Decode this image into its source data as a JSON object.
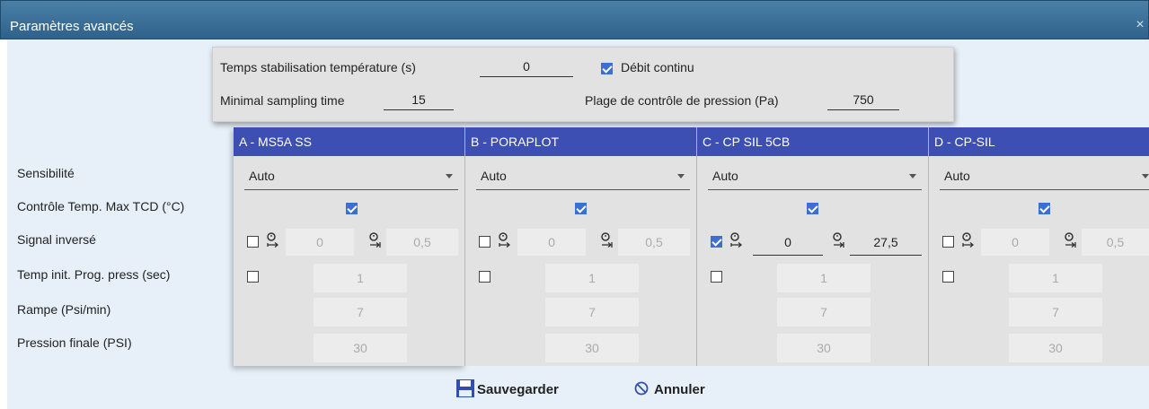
{
  "window": {
    "title": "Paramètres avancés",
    "close_glyph": "×"
  },
  "top": {
    "temp_stab_label": "Temps stabilisation température (s)",
    "temp_stab_value": "0",
    "debit_label": "Débit continu",
    "debit_checked": true,
    "min_sampling_label": "Minimal sampling time",
    "min_sampling_value": "15",
    "plage_label": "Plage de contrôle de pression (Pa)",
    "plage_value": "750"
  },
  "rows": {
    "sensibilite": "Sensibilité",
    "controle": "Contrôle Temp. Max TCD (°C)",
    "signal": "Signal inversé",
    "temp_init": "Temp init. Prog. press (sec)",
    "rampe": "Rampe (Psi/min)",
    "pression": "Pression finale (PSI)"
  },
  "channels": [
    {
      "name": "A - MS5A SS",
      "sensibilite": "Auto",
      "controle": true,
      "signal_checked": false,
      "signal_start": "0",
      "signal_end": "0,5",
      "temp_init_checked": false,
      "temp_init": "1",
      "rampe": "7",
      "pression": "30"
    },
    {
      "name": "B - PORAPLOT",
      "sensibilite": "Auto",
      "controle": true,
      "signal_checked": false,
      "signal_start": "0",
      "signal_end": "0,5",
      "temp_init_checked": false,
      "temp_init": "1",
      "rampe": "7",
      "pression": "30"
    },
    {
      "name": "C - CP SIL 5CB",
      "sensibilite": "Auto",
      "controle": true,
      "signal_checked": true,
      "signal_start": "0",
      "signal_end": "27,5",
      "temp_init_checked": false,
      "temp_init": "1",
      "rampe": "7",
      "pression": "30"
    },
    {
      "name": "D - CP-SIL",
      "sensibilite": "Auto",
      "controle": true,
      "signal_checked": false,
      "signal_start": "0",
      "signal_end": "0,5",
      "temp_init_checked": false,
      "temp_init": "1",
      "rampe": "7",
      "pression": "30"
    }
  ],
  "footer": {
    "save_label": "Sauvegarder",
    "cancel_label": "Annuler"
  },
  "icons": {
    "save": "floppy-disk-icon",
    "cancel": "prohibited-icon",
    "timer_start": "timer-start-icon",
    "timer_end": "timer-end-icon"
  },
  "colors": {
    "titlebar": "#3a6f97",
    "channel_header": "#3d4fb2",
    "checkbox": "#3b6fd1"
  }
}
